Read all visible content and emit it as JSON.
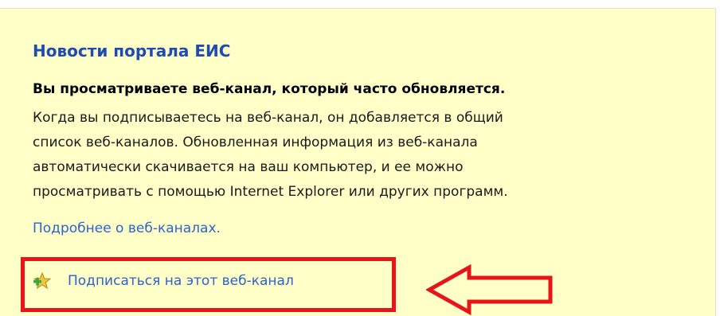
{
  "feed": {
    "title": "Новости портала ЕИС",
    "notice_bold": "Вы просматриваете веб-канал, который часто обновляется.",
    "description_lines": [
      "Когда вы подписываетесь на веб-канал, он добавляется в общий",
      "список веб-каналов. Обновленная информация из веб-канала",
      "автоматически скачивается на ваш компьютер, и ее можно",
      "просматривать с помощью Internet Explorer или других программ."
    ],
    "more_link": "Подробнее о веб-каналах.",
    "subscribe_label": "Подписаться на этот веб-канал",
    "subscribe_icon": "add-favorite-star-icon"
  },
  "colors": {
    "panel_background": "#ffffc8",
    "title": "#1f4bb2",
    "link": "#2e62cc",
    "annotation_red": "#e8141c"
  }
}
